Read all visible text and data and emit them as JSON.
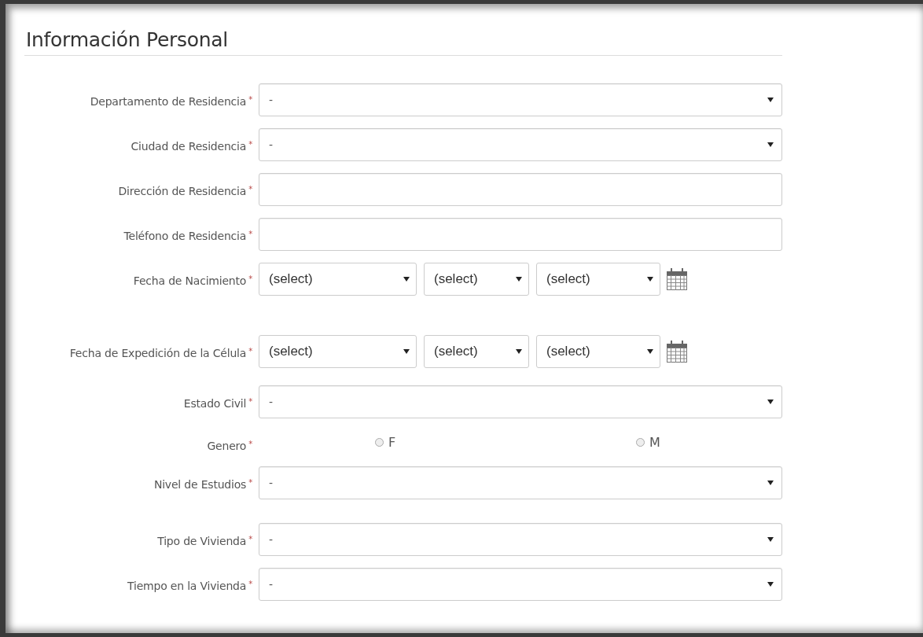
{
  "section": {
    "title": "Información Personal"
  },
  "fields": [
    {
      "kind": "select",
      "label": "Departamento de Residencia",
      "required_mark": "*",
      "value": "-"
    },
    {
      "kind": "select",
      "label": "Ciudad de Residencia",
      "required_mark": "*",
      "value": "-"
    },
    {
      "kind": "text",
      "label": "Dirección de Residencia",
      "required_mark": "*"
    },
    {
      "kind": "text",
      "label": "Teléfono de Residencia",
      "required_mark": "*"
    },
    {
      "kind": "date",
      "label": "Fecha de Nacimiento",
      "required_mark": "*",
      "parts": [
        "(select)",
        "(select)",
        "(select)"
      ]
    },
    {
      "kind": "date",
      "label": "Fecha de Expedición de la Célula",
      "required_mark": "*",
      "parts": [
        "(select)",
        "(select)",
        "(select)"
      ]
    },
    {
      "kind": "select",
      "label": "Estado Civil",
      "required_mark": "*",
      "value": "-"
    },
    {
      "kind": "radio",
      "label": "Genero",
      "required_mark": "*",
      "options": [
        {
          "label": "F",
          "selected": false
        },
        {
          "label": "M",
          "selected": false
        }
      ]
    },
    {
      "kind": "select",
      "label": "Nivel de Estudios",
      "required_mark": "*",
      "value": "-"
    },
    {
      "kind": "select",
      "label": "Tipo de Vivienda",
      "required_mark": "*",
      "value": "-"
    },
    {
      "kind": "select",
      "label": "Tiempo en la Vivienda",
      "required_mark": "*",
      "value": "-"
    }
  ]
}
